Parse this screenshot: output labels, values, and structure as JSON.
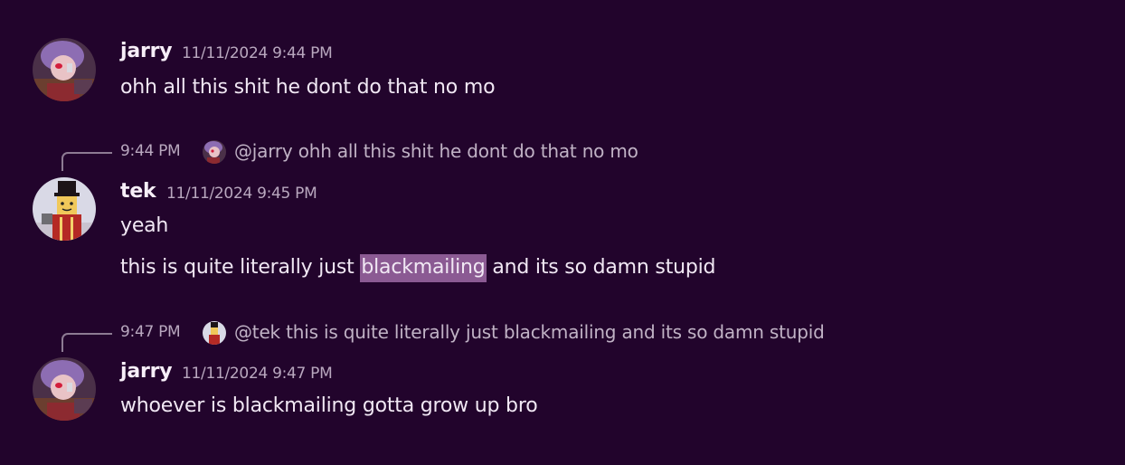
{
  "messages": [
    {
      "username": "jarry",
      "timestamp": "11/11/2024 9:44 PM",
      "lines": [
        "ohh all this shit he dont do that no mo"
      ]
    },
    {
      "reply": {
        "time": "9:44 PM",
        "mention": "@jarry",
        "text": "ohh all this shit he dont do that no mo"
      },
      "username": "tek",
      "timestamp": "11/11/2024 9:45 PM",
      "line1": "yeah",
      "line2_before": "this is quite literally just ",
      "line2_highlight": "blackmailing",
      "line2_after": " and its so damn stupid"
    },
    {
      "reply": {
        "time": "9:47 PM",
        "mention": "@tek",
        "text": "this is quite literally just blackmailing and its so damn stupid"
      },
      "username": "jarry",
      "timestamp": "11/11/2024 9:47 PM",
      "lines": [
        "whoever is blackmailing gotta grow up bro"
      ]
    }
  ],
  "colors": {
    "background": "#22042c",
    "highlight": "#8b5a93",
    "muted_text": "#b9a8bf"
  }
}
